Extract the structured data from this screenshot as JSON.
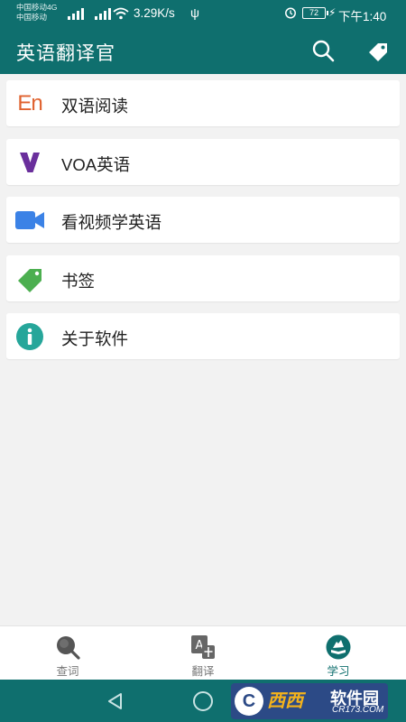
{
  "status_bar": {
    "carrier_1": "中国移动4G",
    "carrier_2": "中国移动",
    "network_speed": "3.29K/s",
    "battery": "72",
    "time": "下午1:40"
  },
  "app_bar": {
    "title": "英语翻译官",
    "search_icon": "search-icon",
    "bookmark_icon": "tag-icon"
  },
  "menu": {
    "items": [
      {
        "label": "双语阅读",
        "icon": "en-icon",
        "icon_text": "En",
        "color": "#e0622f"
      },
      {
        "label": "VOA英语",
        "icon": "voa-icon",
        "color": "#6a2f9c"
      },
      {
        "label": "看视频学英语",
        "icon": "video-camera-icon",
        "color": "#3b82e6"
      },
      {
        "label": "书签",
        "icon": "tag-icon",
        "color": "#4caf50"
      },
      {
        "label": "关于软件",
        "icon": "info-icon",
        "color": "#26a69a"
      }
    ]
  },
  "bottom_nav": {
    "items": [
      {
        "label": "查词",
        "icon": "magnifier-icon",
        "active": false
      },
      {
        "label": "翻译",
        "icon": "translate-icon",
        "active": false
      },
      {
        "label": "学习",
        "icon": "study-icon",
        "active": true
      }
    ]
  },
  "watermark": {
    "logo": "C",
    "text_1": "西西",
    "text_2": "软件园",
    "sub": "CR173.COM"
  },
  "colors": {
    "primary": "#0f6f6e",
    "background": "#f2f2f2"
  }
}
